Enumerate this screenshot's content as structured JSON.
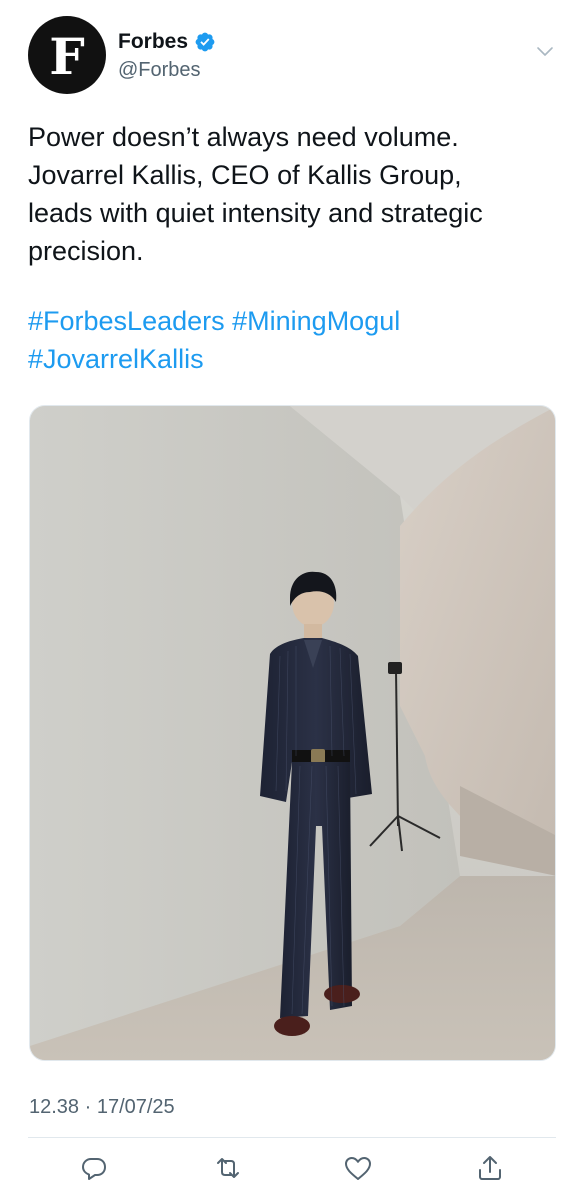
{
  "author": {
    "initial": "F",
    "name": "Forbes",
    "handle": "@Forbes"
  },
  "tweet": {
    "lines": [
      "Power doesn’t always need volume.",
      "Jovarrel Kallis, CEO of Kallis Group,",
      "leads with quiet intensity and strategic",
      "precision."
    ],
    "hashtags": [
      "#ForbesLeaders",
      "#MiningMogul",
      "#JovarrelKallis"
    ],
    "timestamp": "12.38 · 17/07/25"
  },
  "icons": {
    "verified": "verified-badge-icon",
    "more": "chevron-down-icon",
    "reply": "reply-icon",
    "retweet": "retweet-icon",
    "like": "heart-icon",
    "share": "share-icon"
  },
  "colors": {
    "link": "#1d9bf0",
    "secondary_text": "#536471",
    "primary_text": "#0f1419"
  }
}
